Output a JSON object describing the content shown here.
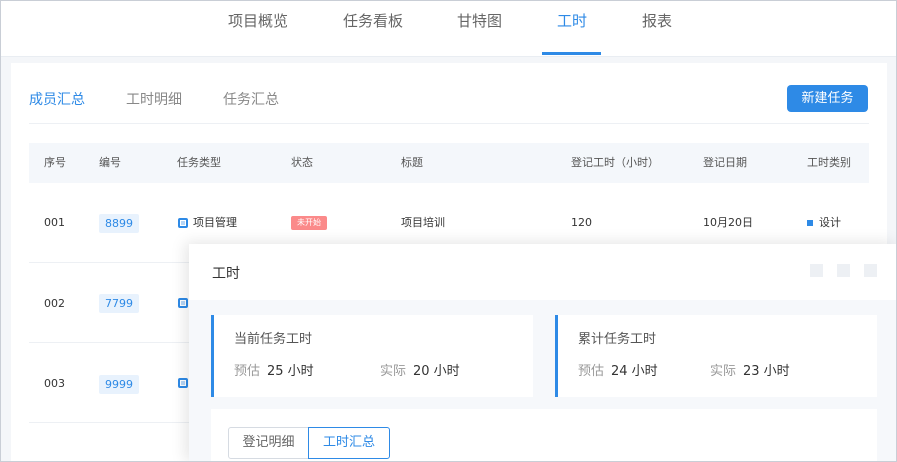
{
  "topnav": {
    "tabs": [
      {
        "label": "项目概览"
      },
      {
        "label": "任务看板"
      },
      {
        "label": "甘特图"
      },
      {
        "label": "工时",
        "active": true
      },
      {
        "label": "报表"
      }
    ]
  },
  "subtabs": [
    {
      "label": "成员汇总",
      "active": true
    },
    {
      "label": "工时明细"
    },
    {
      "label": "任务汇总"
    }
  ],
  "new_task_button": "新建任务",
  "table": {
    "headers": [
      "序号",
      "编号",
      "任务类型",
      "状态",
      "标题",
      "登记工时（小时）",
      "登记日期",
      "工时类别"
    ],
    "rows": [
      {
        "index": "001",
        "code": "8899",
        "type": "项目管理",
        "status": "未开始",
        "title": "项目培训",
        "hours": "120",
        "date": "10月20日",
        "category": "设计"
      },
      {
        "index": "002",
        "code": "7799"
      },
      {
        "index": "003",
        "code": "9999"
      }
    ]
  },
  "panel": {
    "title": "工时",
    "current": {
      "title": "当前任务工时",
      "estimate_label": "预估",
      "estimate_value": "25 小时",
      "actual_label": "实际",
      "actual_value": "20 小时"
    },
    "cumulative": {
      "title": "累计任务工时",
      "estimate_label": "预估",
      "estimate_value": "24 小时",
      "actual_label": "实际",
      "actual_value": "23 小时"
    },
    "segments": [
      {
        "label": "登记明细"
      },
      {
        "label": "工时汇总",
        "active": true
      }
    ]
  },
  "colors": {
    "accent": "#2e8ae6",
    "status_not_started": "#fb8a8a"
  }
}
